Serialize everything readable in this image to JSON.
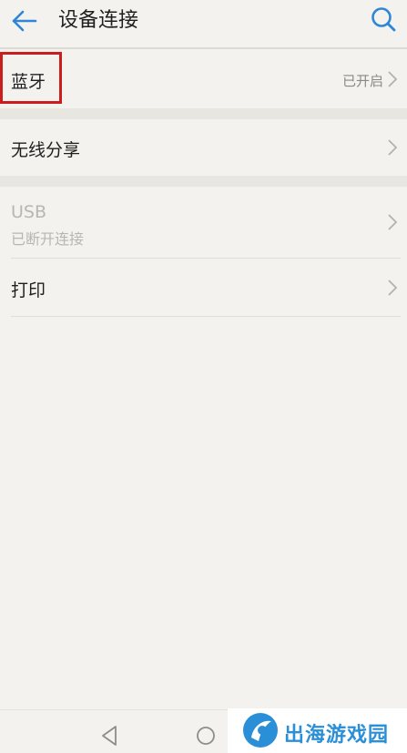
{
  "header": {
    "title": "设备连接"
  },
  "rows": {
    "bluetooth": {
      "label": "蓝牙",
      "value": "已开启"
    },
    "wireless_share": {
      "label": "无线分享"
    },
    "usb": {
      "label": "USB",
      "subtitle": "已断开连接"
    },
    "print": {
      "label": "打印"
    }
  },
  "icons": {
    "back": "back-arrow-icon",
    "search": "search-icon",
    "chevron": "chevron-right-icon",
    "nav_back": "triangle-back-icon",
    "nav_home": "circle-home-icon"
  },
  "colors": {
    "accent": "#2f86d6",
    "highlight_box": "#cc1d1d",
    "background": "#f3f2ee",
    "watermark_text": "#2b8fd8"
  },
  "watermark": {
    "text": "出海游戏园"
  }
}
